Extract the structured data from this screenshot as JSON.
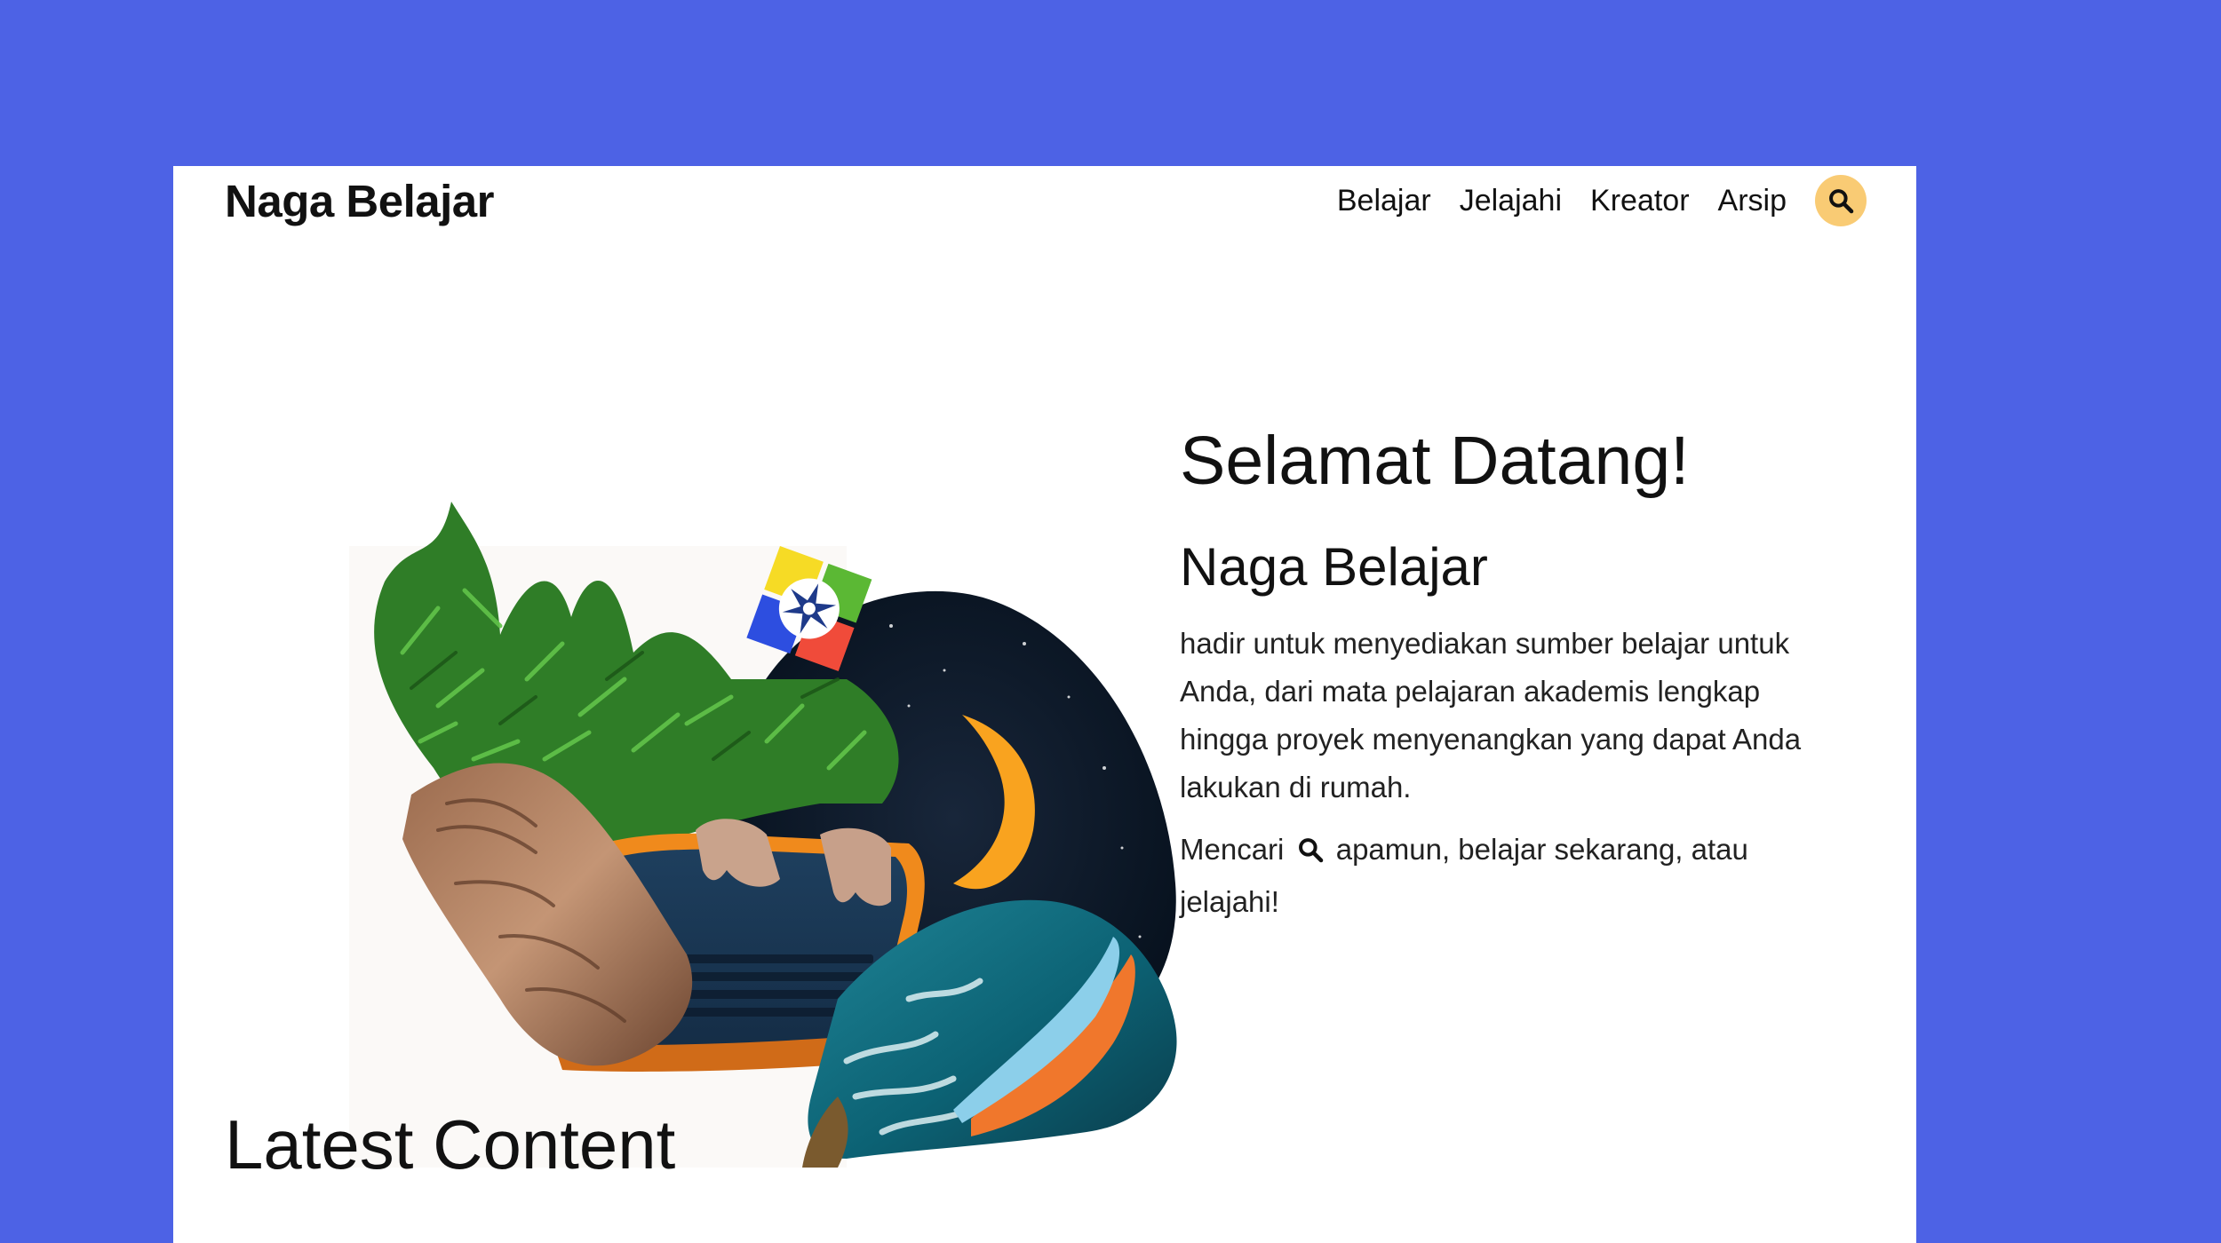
{
  "header": {
    "brand": "Naga Belajar",
    "nav": [
      "Belajar",
      "Jelajahi",
      "Kreator",
      "Arsip"
    ],
    "search_icon": "search-icon"
  },
  "hero": {
    "title": "Selamat Datang!",
    "subtitle": "Naga Belajar",
    "description": "hadir untuk menyediakan sumber belajar untuk Anda, dari mata pelajaran akademis lengkap hingga proyek menyenangkan yang dapat Anda lakukan di rumah.",
    "cta_before": "Mencari",
    "cta_after": "apamun, belajar sekarang, atau jelajahi!",
    "illustration_icon": "collage-illustration"
  },
  "latest": {
    "title": "Latest Content"
  },
  "colors": {
    "background": "#4D62E5",
    "card": "#FFFFFF",
    "search_button": "#F9CB74"
  }
}
